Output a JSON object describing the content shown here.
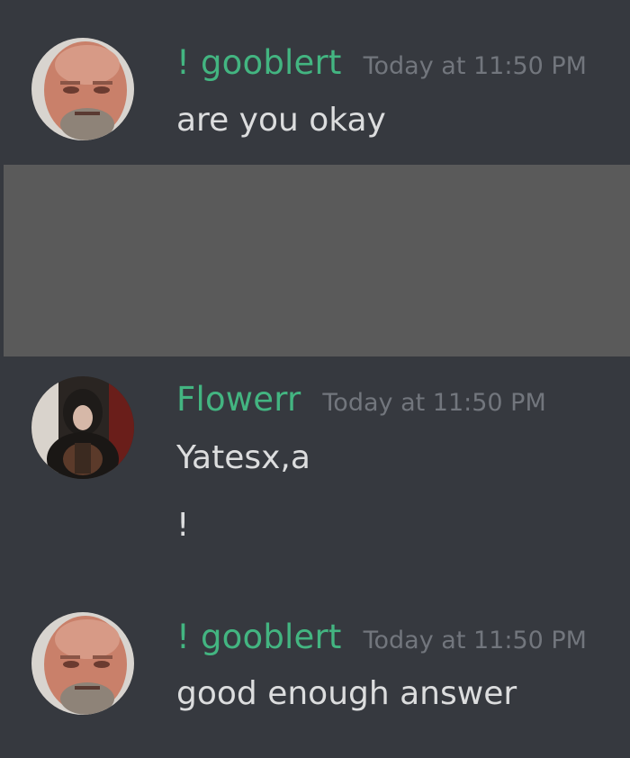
{
  "messages": [
    {
      "username": "! gooblert",
      "timestamp": "Today at 11:50 PM",
      "lines": [
        "are you okay"
      ]
    },
    {
      "username": "Flowerr",
      "timestamp": "Today at 11:50 PM",
      "lines": [
        "Yatesx,a",
        "!"
      ]
    },
    {
      "username": "! gooblert",
      "timestamp": "Today at 11:50 PM",
      "lines": [
        "good enough answer"
      ]
    }
  ],
  "colors": {
    "background": "#36393f",
    "username": "#43b581",
    "timestamp": "#72767d",
    "text": "#dcddde",
    "redaction": "#5a5a5a"
  }
}
